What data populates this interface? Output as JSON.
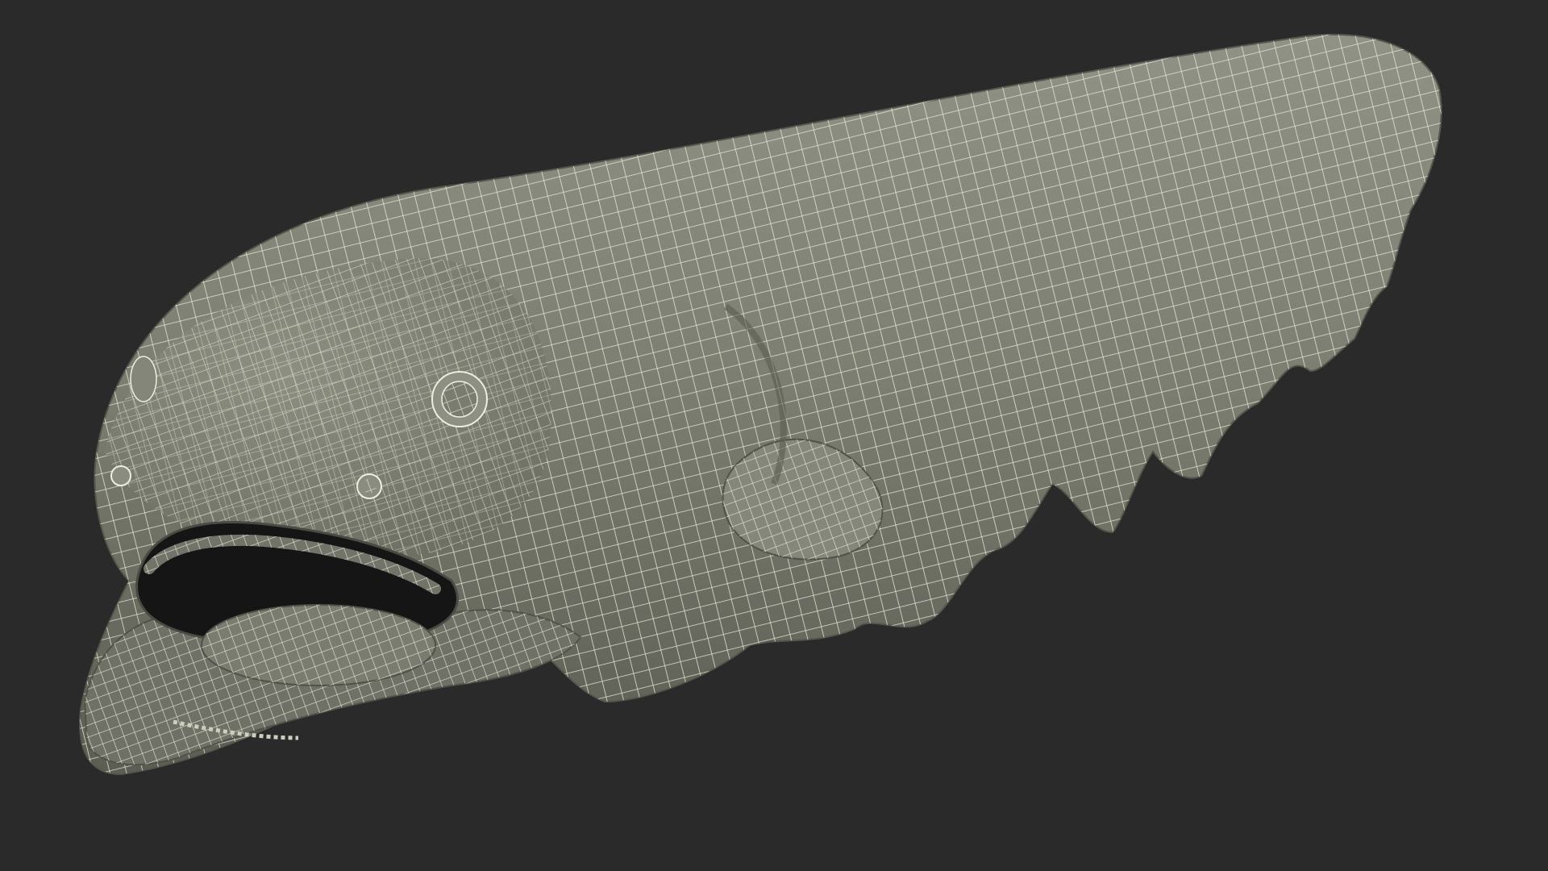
{
  "scene": {
    "subject": "wireframe-eel-model",
    "colors": {
      "background": "#2a2a2a",
      "skin": "#7d7f72",
      "skin_dark": "#5f6157",
      "skin_light": "#9a9c8e",
      "wire": "#efeedd",
      "mouth_interior": "#151515"
    }
  }
}
